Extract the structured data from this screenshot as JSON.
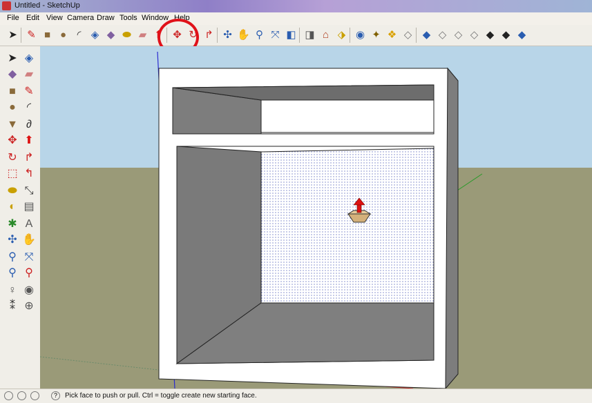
{
  "window": {
    "title": "Untitled - SketchUp"
  },
  "menu": [
    "File",
    "Edit",
    "View",
    "Camera",
    "Draw",
    "Tools",
    "Window",
    "Help"
  ],
  "toolbar": [
    {
      "name": "select-icon",
      "glyph": "➤",
      "color": "#222"
    },
    {
      "name": "pencil-icon",
      "glyph": "✎",
      "color": "#c22"
    },
    {
      "name": "rectangle-icon",
      "glyph": "■",
      "color": "#8a6a3a"
    },
    {
      "name": "circle-icon",
      "glyph": "●",
      "color": "#8a6a3a"
    },
    {
      "name": "arc-icon",
      "glyph": "◜",
      "color": "#333"
    },
    {
      "name": "make-component-icon",
      "glyph": "◈",
      "color": "#2a5db0"
    },
    {
      "name": "paint-bucket-icon",
      "glyph": "◆",
      "color": "#8060a0"
    },
    {
      "name": "tape-measure-icon",
      "glyph": "⬬",
      "color": "#c9a000"
    },
    {
      "name": "eraser-icon",
      "glyph": "▰",
      "color": "#d08080"
    },
    {
      "name": "push-pull-icon",
      "glyph": "⬆",
      "color": "#d11"
    },
    {
      "name": "move-icon",
      "glyph": "✥",
      "color": "#c22"
    },
    {
      "name": "rotate-icon",
      "glyph": "↻",
      "color": "#c22"
    },
    {
      "name": "follow-me-icon",
      "glyph": "↱",
      "color": "#c22"
    },
    {
      "name": "orbit-icon",
      "glyph": "✣",
      "color": "#2a5db0"
    },
    {
      "name": "pan-icon",
      "glyph": "✋",
      "color": "#666"
    },
    {
      "name": "zoom-icon",
      "glyph": "⚲",
      "color": "#2a5db0"
    },
    {
      "name": "zoom-extents-icon",
      "glyph": "⤧",
      "color": "#2a5db0"
    },
    {
      "name": "previous-view-icon",
      "glyph": "◧",
      "color": "#2a5db0"
    },
    {
      "name": "next-view-icon",
      "glyph": "◨",
      "color": "#555"
    },
    {
      "name": "warehouse-icon",
      "glyph": "⌂",
      "color": "#b04020"
    },
    {
      "name": "share-model-icon",
      "glyph": "⬗",
      "color": "#c9a000"
    },
    {
      "name": "google-earth-icon",
      "glyph": "◉",
      "color": "#2a5db0"
    },
    {
      "name": "components-icon",
      "glyph": "✦",
      "color": "#806000"
    },
    {
      "name": "styles-icon",
      "glyph": "❖",
      "color": "#d9a000"
    },
    {
      "name": "layers-icon",
      "glyph": "◇",
      "color": "#777"
    },
    {
      "name": "iso-view-icon",
      "glyph": "◆",
      "color": "#2a5db0"
    },
    {
      "name": "top-view-icon",
      "glyph": "◇",
      "color": "#777"
    },
    {
      "name": "front-view-icon",
      "glyph": "◇",
      "color": "#777"
    },
    {
      "name": "right-view-icon",
      "glyph": "◇",
      "color": "#777"
    },
    {
      "name": "xray-icon",
      "glyph": "◆",
      "color": "#222"
    },
    {
      "name": "wireframe-icon",
      "glyph": "◆",
      "color": "#222"
    },
    {
      "name": "shaded-icon",
      "glyph": "◆",
      "color": "#2a5db0"
    }
  ],
  "left_toolbar": [
    {
      "name": "select-icon",
      "glyph": "➤",
      "color": "#222"
    },
    {
      "name": "make-component-icon",
      "glyph": "◈",
      "color": "#2a5db0"
    },
    {
      "name": "paint-bucket-icon",
      "glyph": "◆",
      "color": "#8060a0"
    },
    {
      "name": "eraser-icon",
      "glyph": "▰",
      "color": "#d08080"
    },
    {
      "name": "rectangle-icon",
      "glyph": "■",
      "color": "#8a6a3a"
    },
    {
      "name": "line-icon",
      "glyph": "✎",
      "color": "#c22"
    },
    {
      "name": "circle-icon",
      "glyph": "●",
      "color": "#8a6a3a"
    },
    {
      "name": "arc-icon",
      "glyph": "◜",
      "color": "#333"
    },
    {
      "name": "polygon-icon",
      "glyph": "▼",
      "color": "#8a6a3a"
    },
    {
      "name": "freehand-icon",
      "glyph": "∂",
      "color": "#333"
    },
    {
      "name": "move-icon",
      "glyph": "✥",
      "color": "#c22"
    },
    {
      "name": "push-pull-icon",
      "glyph": "⬆",
      "color": "#d11"
    },
    {
      "name": "rotate-icon",
      "glyph": "↻",
      "color": "#c22"
    },
    {
      "name": "follow-me-icon",
      "glyph": "↱",
      "color": "#c22"
    },
    {
      "name": "scale-icon",
      "glyph": "⬚",
      "color": "#c22"
    },
    {
      "name": "offset-icon",
      "glyph": "↰",
      "color": "#c22"
    },
    {
      "name": "tape-measure-icon",
      "glyph": "⬬",
      "color": "#c9a000"
    },
    {
      "name": "dimension-icon",
      "glyph": "⤡",
      "color": "#333"
    },
    {
      "name": "protractor-icon",
      "glyph": "◐",
      "color": "#c9a000"
    },
    {
      "name": "text-icon",
      "glyph": "▤",
      "color": "#555"
    },
    {
      "name": "axes-icon",
      "glyph": "✱",
      "color": "#2a8a2a"
    },
    {
      "name": "3d-text-icon",
      "glyph": "A",
      "color": "#555"
    },
    {
      "name": "orbit-icon",
      "glyph": "✣",
      "color": "#2a5db0"
    },
    {
      "name": "pan-icon",
      "glyph": "✋",
      "color": "#666"
    },
    {
      "name": "zoom-icon",
      "glyph": "⚲",
      "color": "#2a5db0"
    },
    {
      "name": "zoom-extents-icon",
      "glyph": "⤧",
      "color": "#2a5db0"
    },
    {
      "name": "zoom-window-icon",
      "glyph": "⚲",
      "color": "#2a5db0"
    },
    {
      "name": "previous-view-icon",
      "glyph": "⚲",
      "color": "#c22"
    },
    {
      "name": "position-camera-icon",
      "glyph": "♀",
      "color": "#555"
    },
    {
      "name": "look-around-icon",
      "glyph": "◉",
      "color": "#555"
    },
    {
      "name": "walk-icon",
      "glyph": "⁑",
      "color": "#333"
    },
    {
      "name": "section-plane-icon",
      "glyph": "⊕",
      "color": "#555"
    }
  ],
  "colors": {
    "sky": "#b8d5e8",
    "ground": "#9a9a78",
    "highlight": "#e0121a",
    "face": "#ffffff",
    "inner": "#808080"
  },
  "status": {
    "message": "Pick face to push or pull.  Ctrl = toggle create new starting face."
  }
}
